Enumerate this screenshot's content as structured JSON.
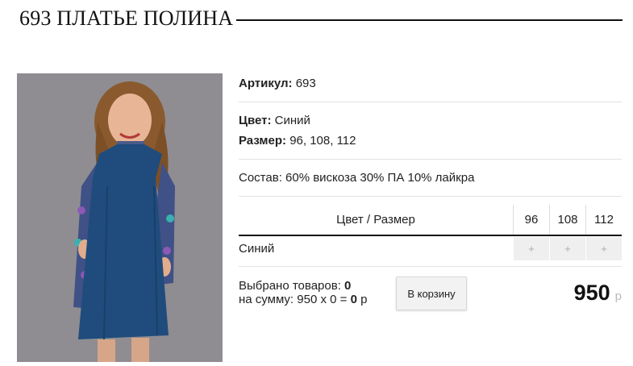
{
  "product": {
    "title": "693 ПЛАТЬЕ ПОЛИНА"
  },
  "details": {
    "article_label": "Артикул:",
    "article_value": "693",
    "color_label": "Цвет:",
    "color_value": "Синий",
    "size_label": "Размер:",
    "size_value": "96, 108, 112",
    "composition": "Состав: 60% вискоза 30% ПА 10% лайкра"
  },
  "size_grid": {
    "header": "Цвет / Размер",
    "sizes": [
      "96",
      "108",
      "112"
    ],
    "rows": [
      {
        "color": "Синий",
        "buttons": [
          "+",
          "+",
          "+"
        ]
      }
    ]
  },
  "summary": {
    "selected_label": "Выбрано товаров:",
    "selected_count": "0",
    "sum_label": "на сумму:",
    "sum_expr": "950 x 0 =",
    "sum_total": "0",
    "sum_currency": "р"
  },
  "cart_button": "В корзину",
  "price": {
    "value": "950",
    "currency": "р"
  },
  "colors": {
    "dress": "#1f4c7c",
    "background": "#8e8c90"
  }
}
